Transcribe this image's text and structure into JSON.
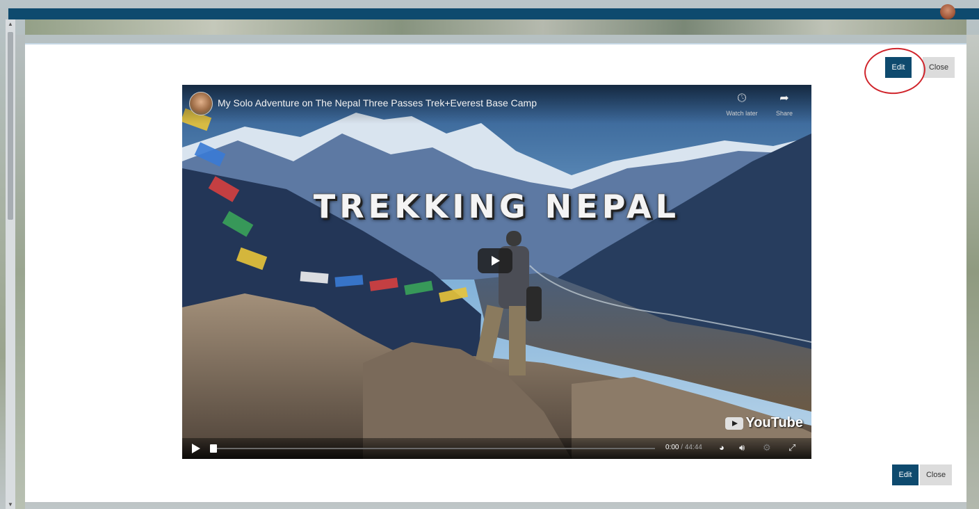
{
  "modal": {
    "edit_label": "Edit",
    "close_label": "Close"
  },
  "video": {
    "title": "My Solo Adventure on The Nepal Three Passes Trek+Everest Base Camp",
    "overlay_text": "TREKKING NEPAL",
    "watch_later_label": "Watch later",
    "share_label": "Share",
    "brand_label": "YouTube",
    "current_time": "0:00",
    "separator": " / ",
    "duration": "44:44",
    "progress_fraction": 0
  },
  "icons": {
    "watch_later": "clock-icon",
    "share": "share-arrow-icon",
    "play": "play-icon",
    "miniplayer": "palette-icon",
    "volume": "volume-icon",
    "settings": "gear-icon",
    "fullscreen": "fullscreen-icon"
  },
  "colors": {
    "topbar": "#0e4a6e",
    "edit_button": "#0e4a6e",
    "close_button": "#dcdcdc",
    "highlight_ring": "#d0242b"
  }
}
